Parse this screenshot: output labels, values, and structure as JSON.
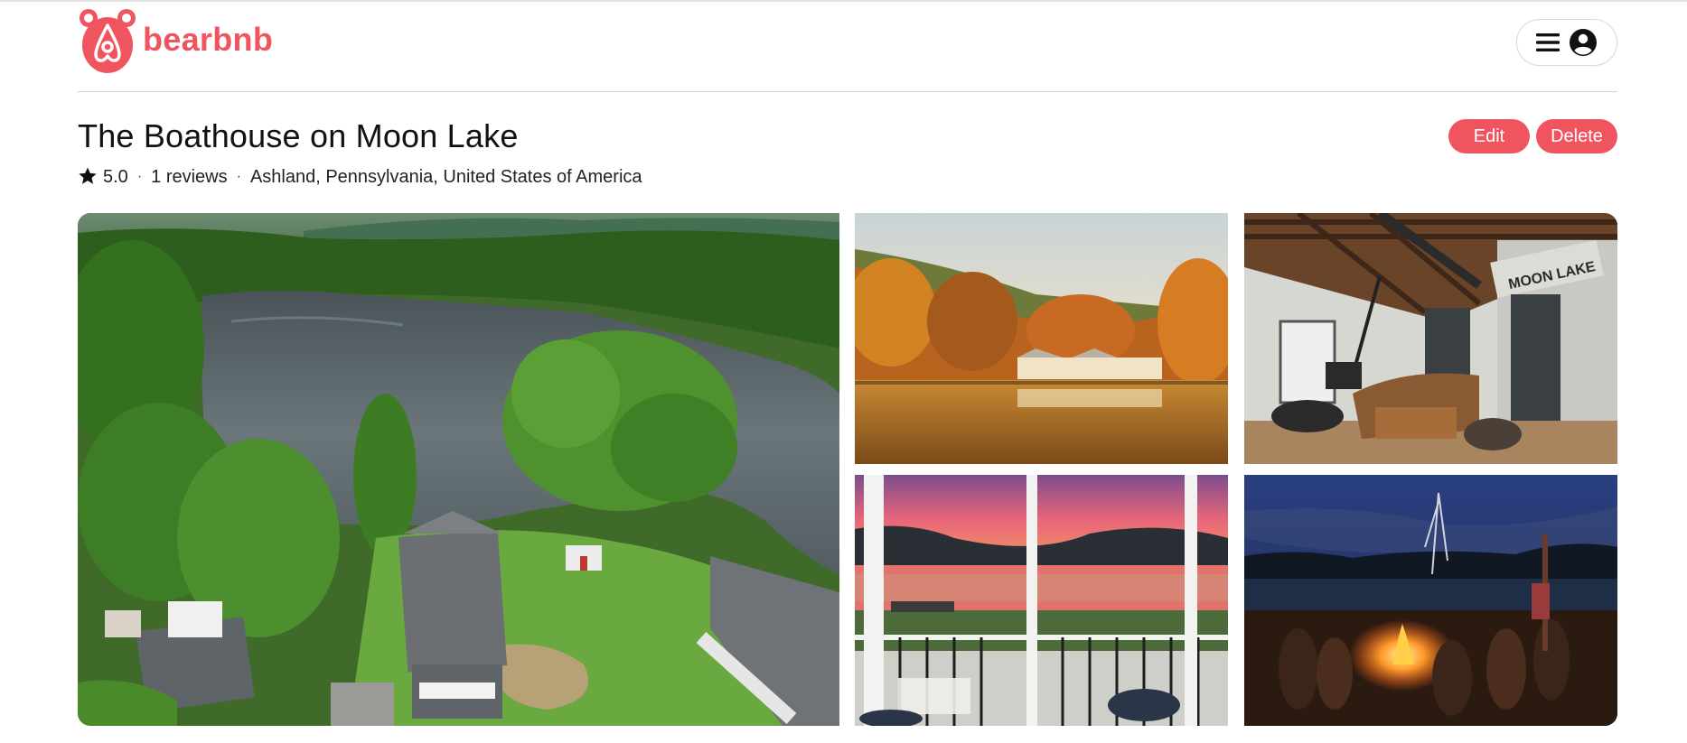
{
  "brand": {
    "name": "bearbnb",
    "color": "#f0555f",
    "logo_icon": "bear-logo-icon"
  },
  "header": {
    "menu_icon": "hamburger-icon",
    "profile_icon": "user-circle-icon"
  },
  "listing": {
    "title": "The Boathouse on Moon Lake",
    "rating": "5.0",
    "reviews": "1 reviews",
    "location": "Ashland, Pennsylvania, United States of America",
    "separator": "·"
  },
  "actions": {
    "edit_label": "Edit",
    "delete_label": "Delete"
  },
  "photos": [
    {
      "subject": "aerial-lake-view"
    },
    {
      "subject": "autumn-lake-reflection"
    },
    {
      "subject": "living-room-interior"
    },
    {
      "subject": "sunset-porch-view"
    },
    {
      "subject": "night-campfire"
    }
  ],
  "interior_sign": "MOON LAKE"
}
